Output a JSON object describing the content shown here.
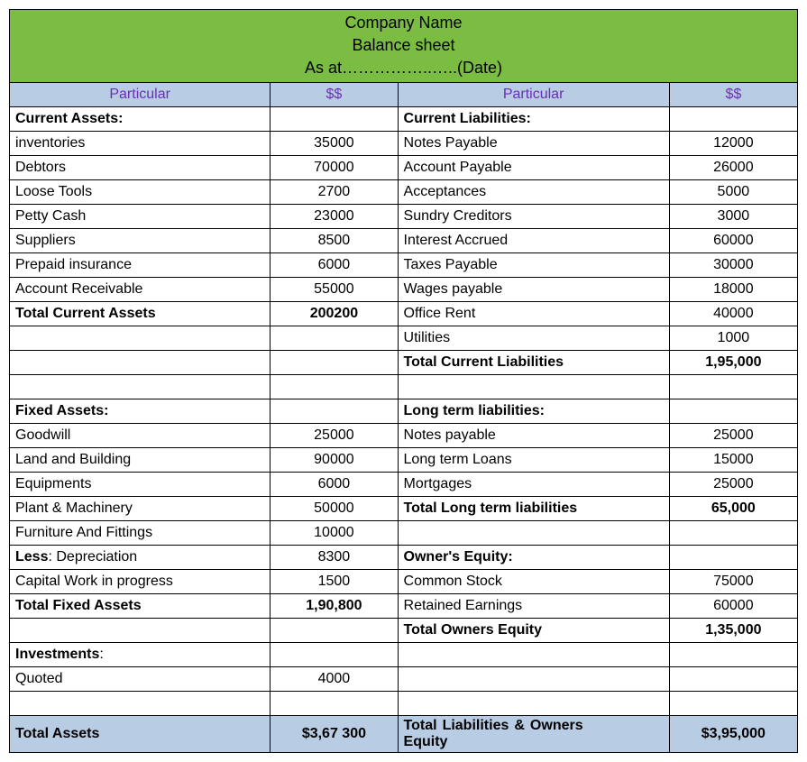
{
  "title": {
    "line1": "Company Name",
    "line2": "Balance sheet",
    "line3": "As at……………..…..(Date)"
  },
  "headers": {
    "left_particular": "Particular",
    "left_amount": "$$",
    "right_particular": "Particular",
    "right_amount": "$$"
  },
  "sections": {
    "current_assets_head": "Current Assets:",
    "current_liabilities_head": "Current Liabilities:",
    "fixed_assets_head": "Fixed Assets:",
    "long_term_liabilities_head": "Long term liabilities:",
    "owners_equity_head": "Owner's Equity:",
    "investments_head": "Investments",
    "less_depreciation": "Less",
    "less_depreciation_suffix": ": Depreciation"
  },
  "current_assets": [
    {
      "label": "inventories",
      "value": "35000"
    },
    {
      "label": "Debtors",
      "value": "70000"
    },
    {
      "label": "Loose Tools",
      "value": "2700"
    },
    {
      "label": "Petty Cash",
      "value": "23000"
    },
    {
      "label": "Suppliers",
      "value": "8500"
    },
    {
      "label": "Prepaid insurance",
      "value": "6000"
    },
    {
      "label": "Account Receivable",
      "value": "55000"
    }
  ],
  "current_assets_total": {
    "label": "Total Current Assets",
    "value": "200200"
  },
  "current_liabilities": [
    {
      "label": "Notes Payable",
      "value": "12000"
    },
    {
      "label": "Account Payable",
      "value": "26000"
    },
    {
      "label": "Acceptances",
      "value": "5000"
    },
    {
      "label": "Sundry Creditors",
      "value": "3000"
    },
    {
      "label": "Interest Accrued",
      "value": "60000"
    },
    {
      "label": "Taxes Payable",
      "value": "30000"
    },
    {
      "label": "Wages payable",
      "value": "18000"
    },
    {
      "label": "Office Rent",
      "value": "40000"
    },
    {
      "label": "Utilities",
      "value": "1000"
    }
  ],
  "current_liabilities_total": {
    "label": "Total Current Liabilities",
    "value": "1,95,000"
  },
  "fixed_assets": [
    {
      "label": "Goodwill",
      "value": "25000"
    },
    {
      "label": "Land and Building",
      "value": "90000"
    },
    {
      "label": "Equipments",
      "value": "6000"
    },
    {
      "label": "Plant & Machinery",
      "value": "50000"
    },
    {
      "label": "Furniture And Fittings",
      "value": "10000"
    }
  ],
  "depreciation_value": "8300",
  "capital_wip": {
    "label": "Capital Work in progress",
    "value": "1500"
  },
  "fixed_assets_total": {
    "label": "Total Fixed Assets",
    "value": "1,90,800"
  },
  "long_term_liabilities": [
    {
      "label": "Notes payable",
      "value": "25000"
    },
    {
      "label": "Long term Loans",
      "value": "15000"
    },
    {
      "label": "Mortgages",
      "value": "25000"
    }
  ],
  "long_term_liabilities_total": {
    "label": "Total Long term liabilities",
    "value": "65,000"
  },
  "owners_equity": [
    {
      "label": "Common Stock",
      "value": "75000"
    },
    {
      "label": "Retained Earnings",
      "value": "60000"
    }
  ],
  "owners_equity_total": {
    "label": "Total Owners Equity",
    "value": "1,35,000"
  },
  "investments": [
    {
      "label": "Quoted",
      "value": "4000"
    }
  ],
  "grand_total_left": {
    "label": "Total Assets",
    "value": "$3,67 300"
  },
  "grand_total_right": {
    "label": "Total Liabilities & Owners Equity",
    "value": "$3,95,000"
  },
  "chart_data": {
    "type": "table",
    "title": "Balance sheet",
    "assets": {
      "current": {
        "inventories": 35000,
        "Debtors": 70000,
        "Loose Tools": 2700,
        "Petty Cash": 23000,
        "Suppliers": 8500,
        "Prepaid insurance": 6000,
        "Account Receivable": 55000,
        "total": 200200
      },
      "fixed": {
        "Goodwill": 25000,
        "Land and Building": 90000,
        "Equipments": 6000,
        "Plant & Machinery": 50000,
        "Furniture And Fittings": 10000,
        "Less Depreciation": 8300,
        "Capital Work in progress": 1500,
        "total": 190800
      },
      "investments": {
        "Quoted": 4000
      },
      "total_assets": 367300
    },
    "liabilities_and_equity": {
      "current_liabilities": {
        "Notes Payable": 12000,
        "Account Payable": 26000,
        "Acceptances": 5000,
        "Sundry Creditors": 3000,
        "Interest Accrued": 60000,
        "Taxes Payable": 30000,
        "Wages payable": 18000,
        "Office Rent": 40000,
        "Utilities": 1000,
        "total": 195000
      },
      "long_term_liabilities": {
        "Notes payable": 25000,
        "Long term Loans": 15000,
        "Mortgages": 25000,
        "total": 65000
      },
      "owners_equity": {
        "Common Stock": 75000,
        "Retained Earnings": 60000,
        "total": 135000
      },
      "total_liabilities_and_equity": 395000
    }
  }
}
